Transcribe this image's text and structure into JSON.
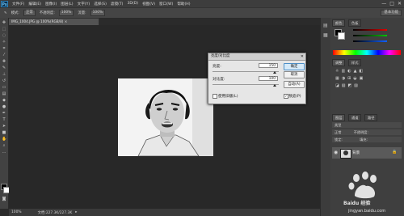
{
  "app": {
    "logo": "Ps"
  },
  "menu": [
    "文件(F)",
    "编辑(E)",
    "图像(I)",
    "图层(L)",
    "文字(Y)",
    "选择(S)",
    "滤镜(T)",
    "3D(D)",
    "视图(V)",
    "窗口(W)",
    "帮助(H)"
  ],
  "window_controls": [
    "—",
    "□",
    "✕"
  ],
  "options_bar": {
    "mode_label": "模式:",
    "mode_value": "正常",
    "opacity_label": "不透明度:",
    "opacity_value": "100%",
    "flow_label": "流量:",
    "flow_value": "100%",
    "workspace": "基本功能"
  },
  "document": {
    "tab_title": "IMG_1004.JPG @ 100%(RGB/8) ×"
  },
  "status_bar": {
    "zoom": "100%",
    "doc_info": "文档:227.3K/227.3K"
  },
  "panels": {
    "color_tabs": [
      "颜色",
      "色板"
    ],
    "adjust_tabs": [
      "调整",
      "样式"
    ],
    "layers_tabs": [
      "图层",
      "通道",
      "路径"
    ],
    "kind_label": "类型",
    "blend_mode": "正常",
    "opacity_label": "不透明度:",
    "lock_label": "锁定:",
    "fill_label": "填充:",
    "layer_name": "背景"
  },
  "dialog": {
    "title": "亮度/对比度",
    "close": "✕",
    "brightness_label": "亮度:",
    "brightness_value": "150",
    "contrast_label": "对比度:",
    "contrast_value": "100",
    "legacy_label": "使用旧版(L)",
    "preview_label": "预览(P)",
    "ok": "确定",
    "cancel": "取消",
    "auto": "自动(A)",
    "preview_checked": "✓"
  },
  "watermark": {
    "text": "Baidu 经验",
    "url": "jingyan.baidu.com"
  },
  "colors": {
    "accent": "#31a8ff",
    "dialog_bg": "#e6e6e6",
    "canvas": "#282828"
  }
}
